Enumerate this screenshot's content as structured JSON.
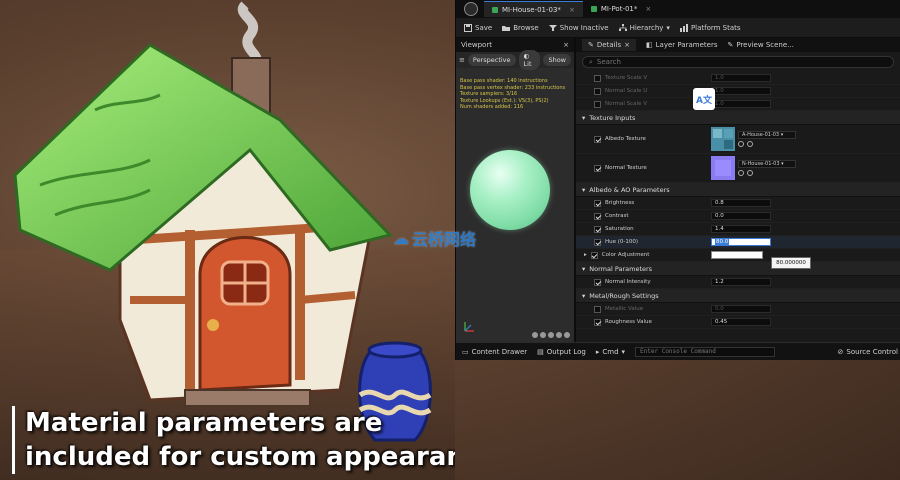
{
  "caption": {
    "line1": "Material parameters are",
    "line2": "included for custom appearances."
  },
  "editor": {
    "tabs": [
      {
        "label": "MI-House-01-03*",
        "active": true
      },
      {
        "label": "MI-Pot-01*",
        "active": false
      }
    ],
    "toolbar": {
      "save": "Save",
      "browse": "Browse",
      "show_inactive": "Show Inactive",
      "hierarchy": "Hierarchy",
      "platform_stats": "Platform Stats"
    },
    "viewport": {
      "title": "Viewport",
      "perspective": "Perspective",
      "lit": "Lit",
      "show": "Show",
      "stats": [
        "Base pass shader: 140 instructions",
        "Base pass vertex shader: 233 instructions",
        "Texture samplers: 3/16",
        "Texture Lookups (Est.): VS(3), PS(2)",
        "Num shaders added: 116"
      ]
    },
    "details": {
      "tabs": {
        "details": "Details",
        "layer_parameters": "Layer Parameters",
        "preview_scene": "Preview Scene..."
      },
      "search_placeholder": "Search",
      "scale_props": [
        {
          "label": "Texture Scale V",
          "value": "1.0"
        },
        {
          "label": "Normal Scale U",
          "value": "1.0"
        },
        {
          "label": "Normal Scale V",
          "value": "1.0"
        }
      ],
      "texture_inputs": {
        "title": "Texture Inputs",
        "albedo": {
          "label": "Albedo Texture",
          "asset": "A-House-01-03"
        },
        "normal": {
          "label": "Normal Texture",
          "asset": "N-House-01-03"
        }
      },
      "albedo_ao": {
        "title": "Albedo & AO Parameters",
        "props": [
          {
            "label": "Brightness",
            "value": "0.8"
          },
          {
            "label": "Contrast",
            "value": "0.0"
          },
          {
            "label": "Saturation",
            "value": "1.4"
          }
        ],
        "hue": {
          "label": "Hue (0-100)",
          "value": "80.0"
        },
        "hue_tooltip": "80.000000",
        "color_adjustment": "Color Adjustment"
      },
      "normal_params": {
        "title": "Normal Parameters",
        "intensity": {
          "label": "Normal Intensity",
          "value": "1.2"
        }
      },
      "metal_rough": {
        "title": "Metal/Rough Settings",
        "metallic": {
          "label": "Metallic Value",
          "value": "0.0"
        },
        "roughness": {
          "label": "Roughness Value",
          "value": "0.45"
        }
      }
    },
    "statusbar": {
      "content_drawer": "Content Drawer",
      "output_log": "Output Log",
      "cmd": "Cmd",
      "cmd_placeholder": "Enter Console Command",
      "source_control": "Source Control"
    }
  },
  "watermark": "云桥网络",
  "colors": {
    "accent": "#3a7bd5",
    "sphere": "#a8f0c6",
    "roof": "#6fcf4a",
    "door": "#d2572e"
  }
}
